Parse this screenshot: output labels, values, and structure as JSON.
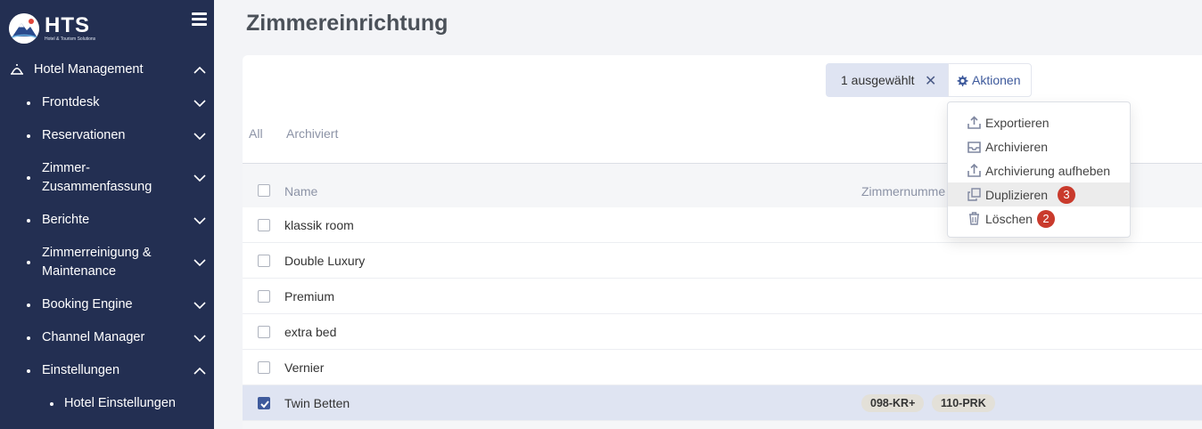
{
  "sidebar": {
    "logo_text": "HTS",
    "logo_subtitle": "Hotel & Tourism Solutions",
    "items": [
      {
        "label": "Hotel Management",
        "expanded": true
      },
      {
        "label": "Frontdesk"
      },
      {
        "label": "Reservationen"
      },
      {
        "label": "Zimmer-",
        "label2": "Zusammenfassung"
      },
      {
        "label": "Berichte"
      },
      {
        "label": "Zimmerreinigung &",
        "label2": "Maintenance"
      },
      {
        "label": "Booking Engine"
      },
      {
        "label": "Channel Manager"
      },
      {
        "label": "Einstellungen",
        "expanded": true
      },
      {
        "label": "Hotel Einstellungen"
      }
    ]
  },
  "page": {
    "title": "Zimmereinrichtung"
  },
  "selection": {
    "label": "1 ausgewählt",
    "close": "✕"
  },
  "actions": {
    "label": "Aktionen",
    "menu": [
      {
        "label": "Exportieren",
        "icon": "upload-icon"
      },
      {
        "label": "Archivieren",
        "icon": "archive-icon"
      },
      {
        "label": "Archivierung aufheben",
        "icon": "unarchive-icon"
      },
      {
        "label": "Duplizieren",
        "icon": "copy-icon",
        "badge": "3"
      },
      {
        "label": "Löschen",
        "icon": "trash-icon",
        "badge": "2"
      }
    ]
  },
  "tabs": [
    "All",
    "Archiviert"
  ],
  "table": {
    "columns": [
      "Name",
      "Zimmernumme"
    ],
    "rows": [
      {
        "name": "klassik room",
        "checked": false,
        "rooms": []
      },
      {
        "name": "Double Luxury",
        "checked": false,
        "rooms": []
      },
      {
        "name": "Premium",
        "checked": false,
        "rooms": []
      },
      {
        "name": "extra bed",
        "checked": false,
        "rooms": []
      },
      {
        "name": "Vernier",
        "checked": false,
        "rooms": []
      },
      {
        "name": "Twin Betten",
        "checked": true,
        "rooms": [
          "098-KR+",
          "110-PRK"
        ]
      }
    ]
  },
  "colors": {
    "sidebar": "#232f52",
    "accent": "#3e5a9c",
    "badge": "#c93a2c",
    "selected_row": "#dfe4f2"
  }
}
